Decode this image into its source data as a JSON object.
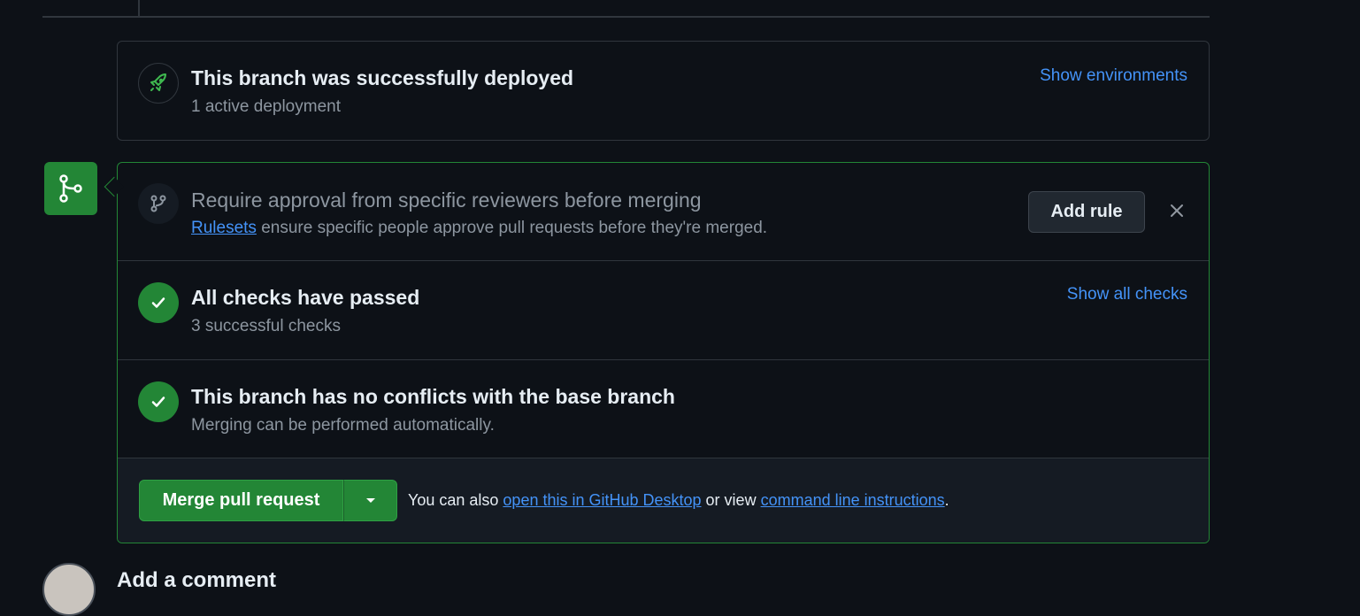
{
  "deployment": {
    "title": "This branch was successfully deployed",
    "subtitle": "1 active deployment",
    "link": "Show environments",
    "icon": "rocket-icon"
  },
  "rules": {
    "title": "Require approval from specific reviewers before merging",
    "link_text": "Rulesets",
    "subtitle_rest": " ensure specific people approve pull requests before they're merged.",
    "button": "Add rule",
    "icon": "git-branch-icon"
  },
  "checks": {
    "title": "All checks have passed",
    "subtitle": "3 successful checks",
    "link": "Show all checks",
    "icon": "check-icon"
  },
  "conflicts": {
    "title": "This branch has no conflicts with the base branch",
    "subtitle": "Merging can be performed automatically.",
    "icon": "check-icon"
  },
  "footer": {
    "merge_button": "Merge pull request",
    "text_1": "You can also ",
    "link_desktop": "open this in GitHub Desktop",
    "text_2": " or view ",
    "link_cli": "command line instructions",
    "text_3": "."
  },
  "comment": {
    "title": "Add a comment"
  },
  "colors": {
    "background": "#0d1117",
    "success": "#238636",
    "link": "#4493f8",
    "muted": "#8d96a0",
    "border": "#30363d"
  }
}
